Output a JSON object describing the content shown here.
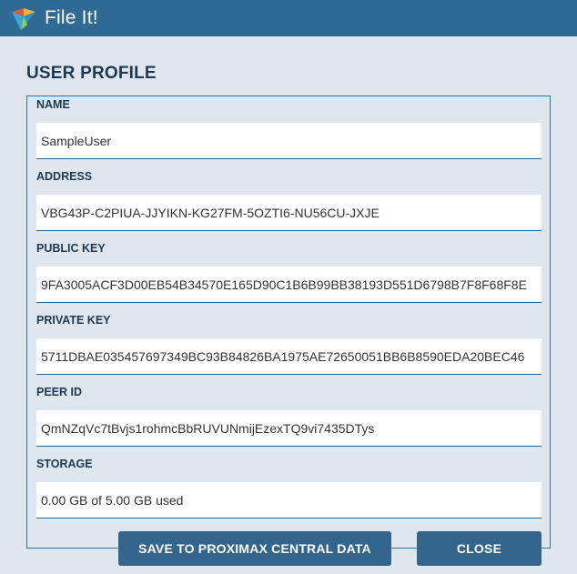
{
  "app": {
    "title": "File It!"
  },
  "heading": "USER PROFILE",
  "fields": [
    {
      "label": "NAME",
      "value": "SampleUser"
    },
    {
      "label": "ADDRESS",
      "value": "VBG43P-C2PIUA-JJYIKN-KG27FM-5OZTI6-NU56CU-JXJE"
    },
    {
      "label": "PUBLIC KEY",
      "value": "9FA3005ACF3D00EB54B34570E165D90C1B6B99BB38193D551D6798B7F8F68F8E"
    },
    {
      "label": "PRIVATE KEY",
      "value": "5711DBAE035457697349BC93B84826BA1975AE72650051BB6B8590EDA20BEC46"
    },
    {
      "label": "PEER ID",
      "value": "QmNZqVc7tBvjs1rohmcBbRUVUNmijEzexTQ9vi7435DTys"
    },
    {
      "label": "STORAGE",
      "value": "0.00 GB of 5.00 GB used"
    }
  ],
  "buttons": {
    "save": "SAVE TO PROXIMAX CENTRAL DATA",
    "close": "CLOSE"
  },
  "colors": {
    "titlebar": "#2f6a94",
    "background": "#dfe6ed",
    "button": "#33658c",
    "heading": "#1c3a52"
  }
}
